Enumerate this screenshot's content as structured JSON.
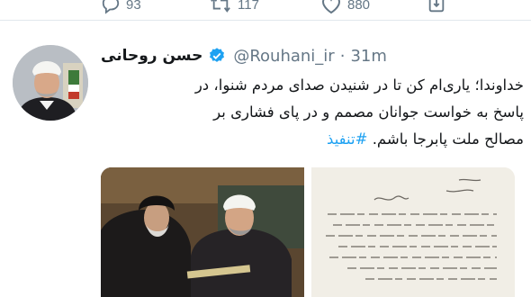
{
  "actions": {
    "reply_count": "93",
    "retweet_count": "117",
    "like_count": "880"
  },
  "tweet": {
    "author_name": "حسن روحانی",
    "handle": "@Rouhani_ir",
    "separator": "·",
    "time": "31m",
    "text_line1": "خداوندا؛ یاری‌ام کن تا در شنیدن صدای مردم شنوا، در",
    "text_line2": "پاسخ به خواست جوانان مصمم و در پای فشاری بر",
    "text_line3": "مصالح ملت پابرجا باشم.",
    "hashtag": "#تنفیذ"
  },
  "colors": {
    "accent": "#1da1f2",
    "secondary_text": "#657786",
    "primary_text": "#14171a"
  }
}
